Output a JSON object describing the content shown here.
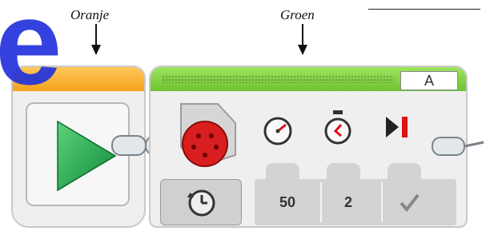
{
  "labels": {
    "orange_label": "Oranje",
    "green_label": "Groen"
  },
  "watermark": {
    "text": "e"
  },
  "start_block": {
    "color": "#f5a21b",
    "icon": "play-icon"
  },
  "motor_block": {
    "color": "#6fc232",
    "port": "A",
    "icons": [
      "large-motor-icon",
      "speed-gauge-icon",
      "timer-icon",
      "brake-at-end-icon"
    ],
    "mode_icon": "time-mode-icon",
    "power": "50",
    "seconds": "2",
    "brake_checked": true
  }
}
